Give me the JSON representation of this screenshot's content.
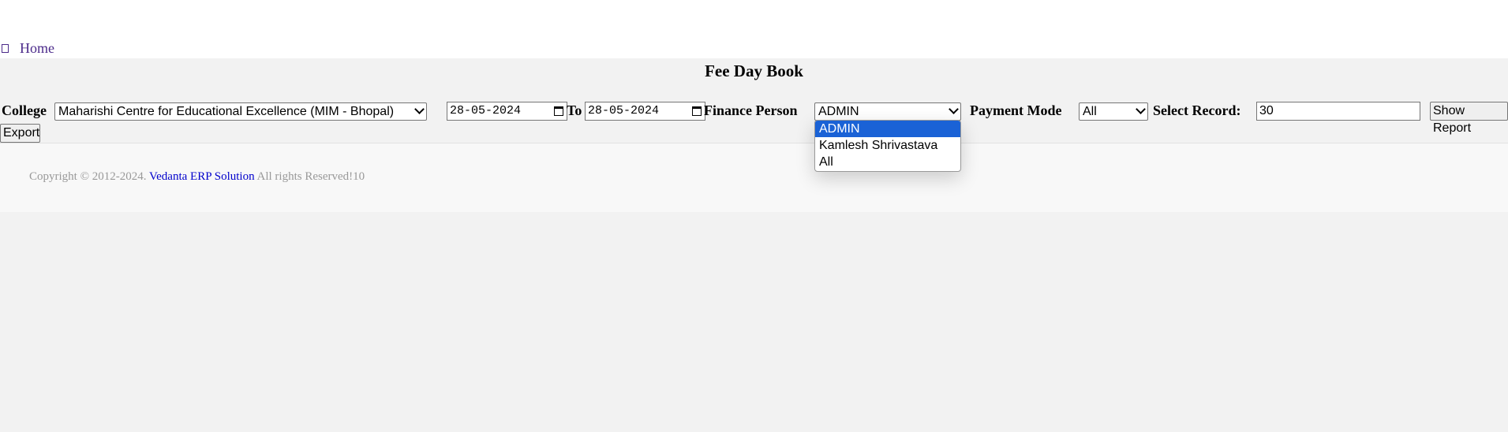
{
  "nav": {
    "home_label": "Home"
  },
  "page": {
    "title": "Fee Day Book"
  },
  "filters": {
    "college_label": "College",
    "college_value": "Maharishi Centre for Educational Excellence (MIM - Bhopal)",
    "date_from": "28-05-2024",
    "to_label": "To",
    "date_to": "28-05-2024",
    "finance_person_label": "Finance Person",
    "finance_person_value": "ADMIN",
    "finance_person_options": [
      "ADMIN",
      "Kamlesh Shrivastava",
      "All"
    ],
    "payment_mode_label": "Payment Mode",
    "payment_mode_value": "All",
    "select_record_label": "Select Record:",
    "select_record_value": "30",
    "show_report_label": "Show Report",
    "export_label": "Export"
  },
  "footer": {
    "copyright_prefix": "Copyright © 2012-2024.",
    "company_link": "Vedanta ERP Solution",
    "suffix": "All rights Reserved!10"
  },
  "colors": {
    "dropdown_selected": "#1a62d6",
    "link": "#0000cc",
    "home_link": "#4b2a8a"
  }
}
